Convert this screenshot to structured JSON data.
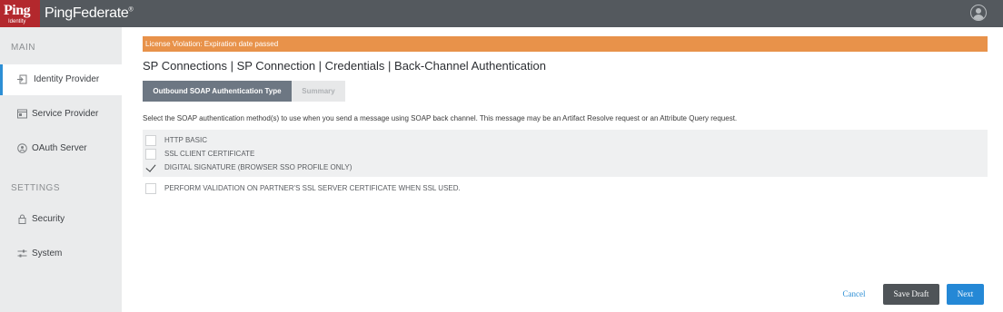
{
  "header": {
    "logo_text": "Ping",
    "logo_subtext": "Identity",
    "app_name": "PingFederate",
    "app_name_mark": "®",
    "user_icon": "user-account-icon",
    "brand_color": "#b3282d",
    "bar_color": "#54595e"
  },
  "sidebar": {
    "main_heading": "MAIN",
    "settings_heading": "SETTINGS",
    "items": [
      {
        "label": "Identity Provider",
        "icon": "identity-provider-icon",
        "active": true
      },
      {
        "label": "Service Provider",
        "icon": "service-provider-icon",
        "active": false
      },
      {
        "label": "OAuth Server",
        "icon": "oauth-server-icon",
        "active": false
      },
      {
        "label": "Security",
        "icon": "lock-icon",
        "active": false
      },
      {
        "label": "System",
        "icon": "sliders-icon",
        "active": false
      }
    ],
    "accent_color": "#2d8fd5"
  },
  "main": {
    "warning": "License Violation: Expiration date passed",
    "warning_color": "#e8924a",
    "breadcrumb": "SP Connections | SP Connection | Credentials | Back-Channel Authentication",
    "tabs": [
      {
        "label": "Outbound SOAP Authentication Type",
        "active": true
      },
      {
        "label": "Summary",
        "active": false
      }
    ],
    "instructions": "Select the SOAP authentication method(s) to use when you send a message using SOAP back channel. This message may be an Artifact Resolve request or an Attribute Query request.",
    "options": [
      {
        "label": "HTTP BASIC",
        "checked": false
      },
      {
        "label": "SSL CLIENT CERTIFICATE",
        "checked": false
      },
      {
        "label": "DIGITAL SIGNATURE (BROWSER SSO PROFILE ONLY)",
        "checked": true
      }
    ],
    "validation_option": {
      "label": "PERFORM VALIDATION ON PARTNER'S SSL SERVER CERTIFICATE WHEN SSL USED.",
      "checked": false
    }
  },
  "footer": {
    "cancel_label": "Cancel",
    "save_draft_label": "Save Draft",
    "next_label": "Next",
    "next_color": "#2488d6"
  }
}
